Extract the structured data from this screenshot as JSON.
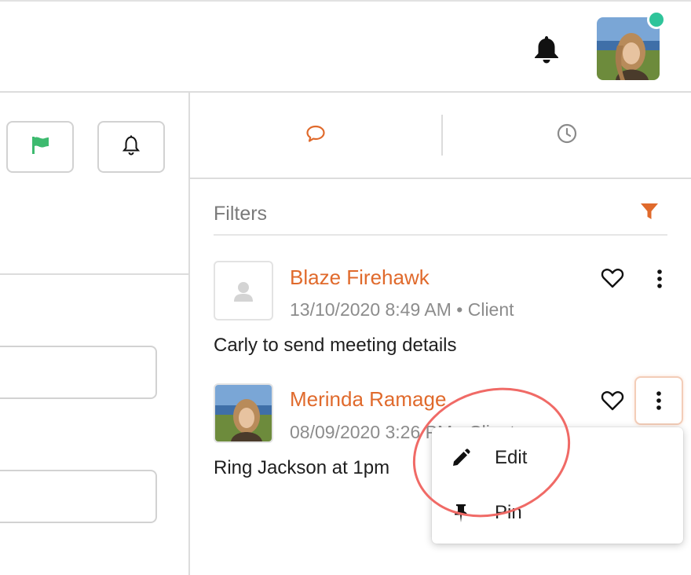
{
  "header": {
    "bell_icon": "bell-icon",
    "user_avatar": "user-photo",
    "online_status_color": "#2fc49a"
  },
  "toolbar": {
    "flag_icon": "flag-icon",
    "flag_color": "#3dba6f",
    "bell_icon": "bell-outline-icon"
  },
  "tabs": {
    "notes_icon": "chat-bubble-icon",
    "history_icon": "clock-icon",
    "accent": "#e06a2c"
  },
  "filters": {
    "label": "Filters",
    "icon": "funnel-icon"
  },
  "notes": [
    {
      "author": "Blaze Firehawk",
      "meta": "13/10/2020 8:49 AM • Client",
      "text": "Carly to send meeting details",
      "avatar": "placeholder-person-icon"
    },
    {
      "author": "Merinda Ramage",
      "meta": "08/09/2020 3:26 PM • Client",
      "text": "Ring Jackson at 1pm",
      "avatar": "user-photo"
    }
  ],
  "context_menu": {
    "items": [
      {
        "label": "Edit",
        "icon": "pencil-icon"
      },
      {
        "label": "Pin",
        "icon": "pin-icon"
      }
    ]
  },
  "annotation_color": "#f06a66"
}
